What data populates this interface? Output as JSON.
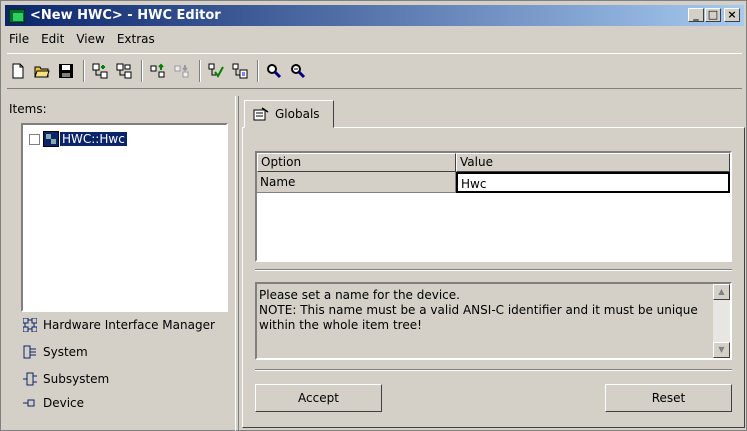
{
  "window": {
    "title": "<New HWC> - HWC Editor"
  },
  "title_buttons": {
    "minimize": "_",
    "maximize": "□",
    "close": "×"
  },
  "menu": [
    "File",
    "Edit",
    "View",
    "Extras"
  ],
  "toolbar": {
    "icons": [
      "new-file-icon",
      "open-folder-icon",
      "save-icon",
      "add-item-icon",
      "add-subitem-icon",
      "move-up-icon",
      "move-down-icon",
      "check-icon",
      "generate-icon",
      "zoom-in-icon",
      "zoom-out-icon"
    ]
  },
  "left": {
    "label": "Items:",
    "tree": [
      {
        "label": "HWC::Hwc",
        "selected": true
      }
    ],
    "legend": [
      {
        "label": "Hardware Interface Manager",
        "icon": "hardware-manager-icon"
      },
      {
        "label": "System",
        "icon": "system-icon"
      },
      {
        "label": "Subsystem",
        "icon": "subsystem-icon"
      },
      {
        "label": "Device",
        "icon": "device-icon"
      }
    ]
  },
  "tab": {
    "label": "Globals"
  },
  "grid": {
    "columns": [
      "Option",
      "Value"
    ],
    "rows": [
      {
        "option": "Name",
        "value": "Hwc"
      }
    ]
  },
  "message": {
    "line1": "Please set a name for the device.",
    "line2": "NOTE: This name must be a valid ANSI-C identifier and it must be unique",
    "line3": "within the whole item tree!"
  },
  "buttons": {
    "accept": "Accept",
    "reset": "Reset"
  }
}
